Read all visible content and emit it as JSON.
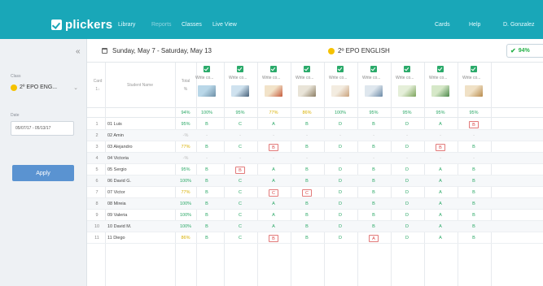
{
  "topbar": {
    "logo": "plickers",
    "nav": [
      "Library",
      "Reports",
      "Classes",
      "Live View"
    ],
    "right_nav": [
      "Cards",
      "Help",
      "D. Gonzalez"
    ]
  },
  "sidebar": {
    "collapse_icon": "chevron-double-left-icon",
    "class_label": "Class",
    "class_value": "2º EPO ENG...",
    "date_label": "Date",
    "date_value": "05/07/17 - 05/13/17",
    "apply_label": "Apply"
  },
  "header": {
    "date_range": "Sunday, May 7 - Saturday, May 13",
    "class_name": "2º EPO ENGLISH",
    "overall": "94%"
  },
  "table": {
    "card_header": "Card",
    "card_sort": "1↓",
    "name_header": "Student Name",
    "total_header": "Total",
    "total_unit": "%",
    "total_overall": "94%",
    "question_title": "Write co...",
    "question_percents": [
      "100%",
      "95%",
      "77%",
      "86%",
      "100%",
      "95%",
      "95%",
      "95%",
      "95%"
    ],
    "rows": [
      {
        "card": "1",
        "name": "01 Luis",
        "total": "95%",
        "answers": [
          "B",
          "C",
          "A",
          "B",
          "D",
          "B",
          "D",
          "A",
          "B"
        ],
        "boxed": [
          8
        ]
      },
      {
        "card": "2",
        "name": "02 Amin",
        "total": "-%",
        "answers": [
          "-",
          "-",
          "-",
          "-",
          "-",
          "-",
          "-",
          "-",
          "-"
        ],
        "boxed": []
      },
      {
        "card": "3",
        "name": "03 Alejandro",
        "total": "77%",
        "answers": [
          "B",
          "C",
          "B",
          "B",
          "D",
          "B",
          "D",
          "B",
          "B"
        ],
        "boxed": [
          2,
          7
        ]
      },
      {
        "card": "4",
        "name": "04 Victoria",
        "total": "-%",
        "answers": [
          "-",
          "-",
          "-",
          "-",
          "-",
          "-",
          "-",
          "-",
          "-"
        ],
        "boxed": []
      },
      {
        "card": "5",
        "name": "05 Sergio",
        "total": "95%",
        "answers": [
          "B",
          "B",
          "A",
          "B",
          "D",
          "B",
          "D",
          "A",
          "B"
        ],
        "boxed": [
          1
        ]
      },
      {
        "card": "6",
        "name": "06 David G.",
        "total": "100%",
        "answers": [
          "B",
          "C",
          "A",
          "B",
          "D",
          "B",
          "D",
          "A",
          "B"
        ],
        "boxed": []
      },
      {
        "card": "7",
        "name": "07 Victor",
        "total": "77%",
        "answers": [
          "B",
          "C",
          "C",
          "C",
          "D",
          "B",
          "D",
          "A",
          "B"
        ],
        "boxed": [
          2,
          3
        ]
      },
      {
        "card": "8",
        "name": "08 Mireia",
        "total": "100%",
        "answers": [
          "B",
          "C",
          "A",
          "B",
          "D",
          "B",
          "D",
          "A",
          "B"
        ],
        "boxed": []
      },
      {
        "card": "9",
        "name": "09 Valeria",
        "total": "100%",
        "answers": [
          "B",
          "C",
          "A",
          "B",
          "D",
          "B",
          "D",
          "A",
          "B"
        ],
        "boxed": []
      },
      {
        "card": "10",
        "name": "10 David M.",
        "total": "100%",
        "answers": [
          "B",
          "C",
          "A",
          "B",
          "D",
          "B",
          "D",
          "A",
          "B"
        ],
        "boxed": []
      },
      {
        "card": "11",
        "name": "11 Diego",
        "total": "86%",
        "answers": [
          "B",
          "C",
          "B",
          "B",
          "D",
          "A",
          "D",
          "A",
          "B"
        ],
        "boxed": [
          2,
          5
        ]
      }
    ]
  },
  "colors": {
    "brand": "#19a7b8",
    "correct": "#2aa866",
    "warn": "#d8b000",
    "wrong": "#e05050",
    "apply": "#5a93d1"
  },
  "icons": {
    "logo": "plickers-check-icon",
    "calendar": "calendar-icon",
    "check": "check-icon",
    "dropdown": "chevron-down-icon"
  }
}
